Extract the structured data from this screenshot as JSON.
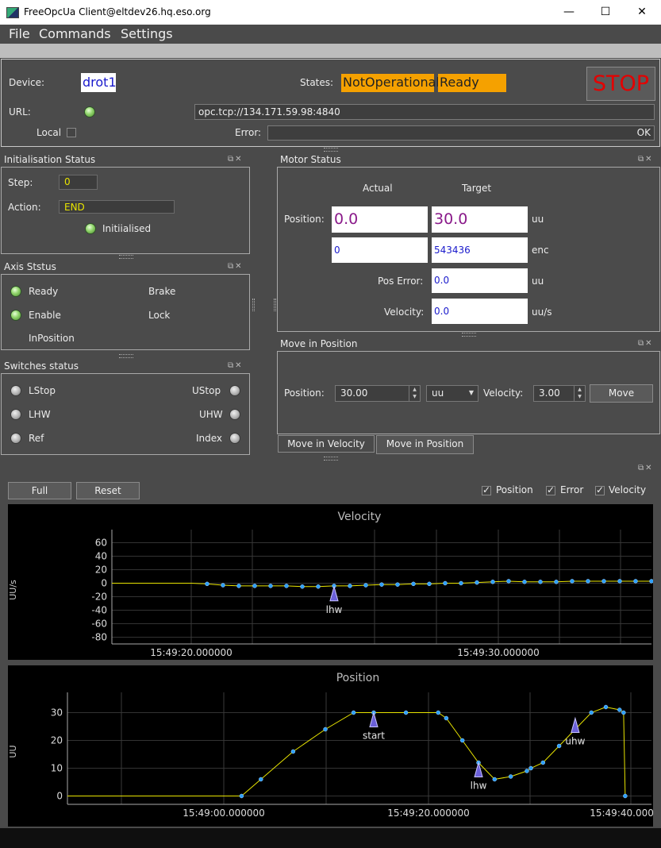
{
  "window": {
    "title": "FreeOpcUa Client@eltdev26.hq.eso.org",
    "minimize": "—",
    "maximize": "☐",
    "close": "✕"
  },
  "menu": [
    "File",
    "Commands",
    "Settings"
  ],
  "device": {
    "device_label": "Device:",
    "device_value": "drot1",
    "states_label": "States:",
    "state1": "NotOperational",
    "state2": "Ready",
    "stop_label": "STOP",
    "url_label": "URL:",
    "url_value": "opc.tcp://134.171.59.98:4840",
    "local_label": "Local",
    "error_label": "Error:",
    "error_value": "OK"
  },
  "init": {
    "title": "Initialisation Status",
    "step_label": "Step:",
    "step_value": "0",
    "action_label": "Action:",
    "action_value": "END",
    "status_label": "Initiialised"
  },
  "axis": {
    "title": "Axis Ststus",
    "ready": "Ready",
    "enable": "Enable",
    "inposition": "InPosition",
    "brake": "Brake",
    "lock": "Lock"
  },
  "switches": {
    "title": "Switches status",
    "lstop": "LStop",
    "lhw": "LHW",
    "ref": "Ref",
    "ustop": "UStop",
    "uhw": "UHW",
    "index": "Index"
  },
  "motor": {
    "title": "Motor Status",
    "actual_header": "Actual",
    "target_header": "Target",
    "position_label": "Position:",
    "pos_actual": "0.0",
    "pos_target": "30.0",
    "pos_unit": "uu",
    "enc_actual": "0",
    "enc_target": "543436",
    "enc_unit": "enc",
    "poserr_label": "Pos Error:",
    "poserr_value": "0.0",
    "poserr_unit": "uu",
    "velocity_label": "Velocity:",
    "velocity_value": "0.0",
    "velocity_unit": "uu/s"
  },
  "move": {
    "title": "Move in Position",
    "position_label": "Position:",
    "position_value": "30.00",
    "unit_value": "uu",
    "velocity_label": "Velocity:",
    "velocity_value": "3.00",
    "move_button": "Move",
    "tab1": "Move in Velocity",
    "tab2": "Move in Position"
  },
  "plots": {
    "full_button": "Full",
    "reset_button": "Reset",
    "chk_position": "Position",
    "chk_error": "Error",
    "chk_velocity": "Velocity"
  },
  "chart_data": [
    {
      "type": "line",
      "title": "Velocity",
      "ylabel": "UU/s",
      "ylim": [
        -90,
        70
      ],
      "yticks": [
        "60",
        "40",
        "20",
        "0",
        "-20",
        "-40",
        "-60",
        "-80"
      ],
      "xticks": [
        "15:49:20.000000",
        "15:49:30.000000"
      ],
      "annotations": [
        "lhw"
      ],
      "series": [
        {
          "x": [
            0,
            10,
            20,
            30,
            40,
            60,
            80,
            100,
            120,
            140,
            160,
            180,
            200,
            220,
            240,
            260,
            280,
            300,
            320,
            340,
            360,
            380,
            400,
            420,
            440,
            460,
            480,
            500,
            520,
            540,
            560,
            580,
            600,
            620,
            640,
            660,
            680
          ],
          "values": [
            0,
            0,
            0,
            0,
            0,
            0,
            0,
            0,
            -1,
            -3,
            -4,
            -4,
            -4,
            -4,
            -5,
            -5,
            -4,
            -4,
            -3,
            -2,
            -2,
            -1,
            -1,
            0,
            0,
            1,
            2,
            3,
            2,
            2,
            2,
            3,
            3,
            3,
            3,
            3,
            3
          ]
        }
      ]
    },
    {
      "type": "line",
      "title": "Position",
      "ylabel": "UU",
      "ylim": [
        -3,
        35
      ],
      "yticks": [
        "30",
        "20",
        "10",
        "0"
      ],
      "xticks": [
        "15:49:00.000000",
        "15:49:20.000000",
        "15:49:40.000000"
      ],
      "annotations": [
        "start",
        "lhw",
        "uhw"
      ],
      "series": [
        {
          "x": [
            0,
            50,
            100,
            150,
            200,
            216,
            240,
            280,
            320,
            355,
            380,
            420,
            460,
            470,
            490,
            510,
            530,
            550,
            570,
            575,
            590,
            610,
            630,
            650,
            668,
            685,
            690,
            692
          ],
          "values": [
            0,
            0,
            0,
            0,
            0,
            0,
            6,
            16,
            24,
            30,
            30,
            30,
            30,
            28,
            20,
            12,
            6,
            7,
            9,
            10,
            12,
            18,
            24,
            30,
            32,
            31,
            30,
            0
          ]
        }
      ]
    }
  ]
}
